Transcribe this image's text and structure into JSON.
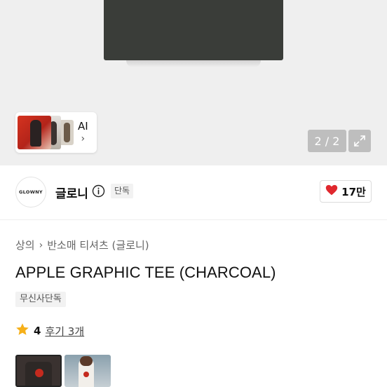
{
  "hero": {
    "ai_card": {
      "label": "AI",
      "chevron": "›"
    },
    "counter": "2 / 2",
    "fullscreen_icon": "expand-icon"
  },
  "brand": {
    "logo_text": "GLOWNY",
    "name": "글로니",
    "info_icon": "info-icon",
    "badge": "단독",
    "likes": "17만",
    "heart_color": "#e0282e"
  },
  "product": {
    "breadcrumb": [
      "상의",
      "반소매 티셔츠 (글로니)"
    ],
    "breadcrumb_sep": "›",
    "title": "APPLE GRAPHIC TEE (CHARCOAL)",
    "tag": "무신사단독",
    "rating": "4",
    "review_link": "후기 3개",
    "star_color": "#f6b01a"
  }
}
